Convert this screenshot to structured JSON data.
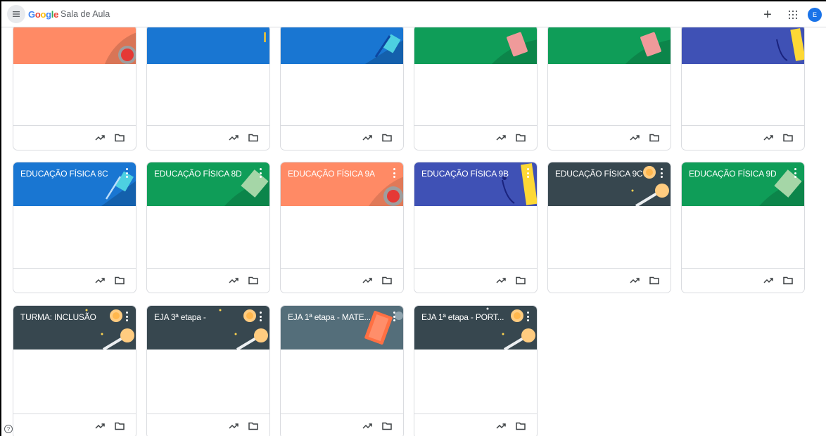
{
  "app": {
    "brand": [
      "G",
      "o",
      "o",
      "g",
      "l",
      "e"
    ],
    "product": "Sala de Aula",
    "add_symbol": "+",
    "avatar_initial": "E",
    "help_symbol": "?"
  },
  "colors": {
    "orange": "#ff8a65",
    "blue": "#1976d2",
    "green": "#1e8e3e",
    "teal": "#0f9d58",
    "indigo": "#3f51b5",
    "dark": "#37474f",
    "slate": "#546e7a"
  },
  "cards_row1": [
    {
      "color": "orange"
    },
    {
      "color": "blue"
    },
    {
      "color": "blue"
    },
    {
      "color": "teal"
    },
    {
      "color": "teal"
    },
    {
      "color": "indigo"
    }
  ],
  "cards_row2": [
    {
      "title": "EDUCAÇÃO FÍSICA 8C",
      "color": "blue"
    },
    {
      "title": "EDUCAÇÃO FÍSICA 8D",
      "color": "teal"
    },
    {
      "title": "EDUCAÇÃO FÍSICA 9A",
      "color": "orange"
    },
    {
      "title": "EDUCAÇÃO FÍSICA 9B",
      "color": "indigo"
    },
    {
      "title": "EDUCAÇÃO FÍSICA 9C",
      "color": "dark"
    },
    {
      "title": "EDUCAÇÃO FÍSICA 9D",
      "color": "teal"
    }
  ],
  "cards_row3": [
    {
      "title": "TURMA: INCLUSÃO",
      "color": "dark"
    },
    {
      "title": "EJA 3ª etapa -",
      "color": "dark"
    },
    {
      "title": "EJA 1ª etapa - MATE...",
      "color": "slate"
    },
    {
      "title": "EJA 1ª etapa - PORT...",
      "color": "dark"
    }
  ]
}
